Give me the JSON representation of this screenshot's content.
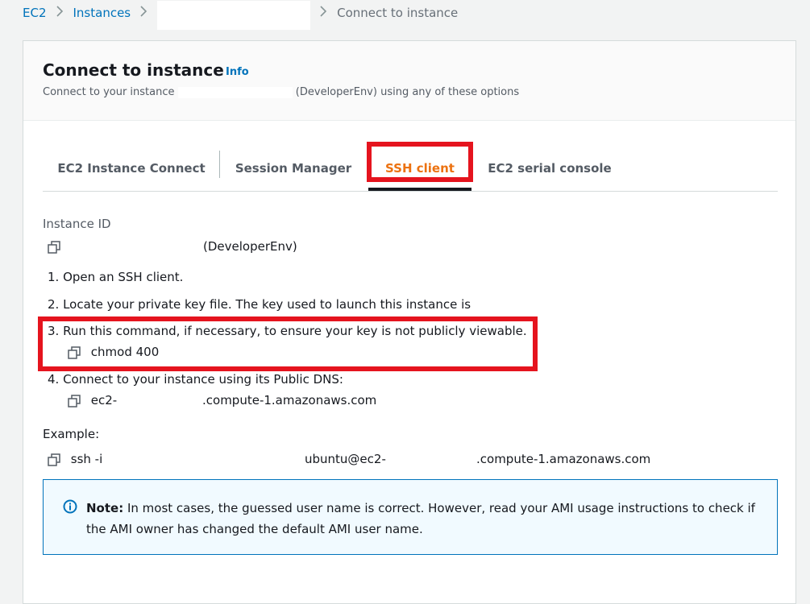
{
  "breadcrumb": {
    "items": [
      "EC2",
      "Instances"
    ],
    "current": "Connect to instance"
  },
  "header": {
    "title": "Connect to instance",
    "info_label": "Info",
    "subtitle_prefix": "Connect to your instance",
    "subtitle_suffix": "(DeveloperEnv) using any of these options"
  },
  "tabs": [
    {
      "label": "EC2 Instance Connect",
      "active": false
    },
    {
      "label": "Session Manager",
      "active": false
    },
    {
      "label": "SSH client",
      "active": true
    },
    {
      "label": "EC2 serial console",
      "active": false
    }
  ],
  "instance": {
    "label": "Instance ID",
    "name": "(DeveloperEnv)"
  },
  "steps": {
    "step1": "1. Open an SSH client.",
    "step2": "2. Locate your private key file. The key used to launch this instance is",
    "step3": "3. Run this command, if necessary, to ensure your key is not publicly viewable.",
    "step3_command": "chmod 400",
    "step4": "4. Connect to your instance using its Public DNS:",
    "step4_dns_prefix": "ec2-",
    "step4_dns_suffix": ".compute-1.amazonaws.com"
  },
  "example": {
    "label": "Example:",
    "command_prefix": "ssh -i",
    "command_user": "ubuntu@ec2-",
    "command_suffix": ".compute-1.amazonaws.com"
  },
  "note": {
    "strong": "Note:",
    "text": " In most cases, the guessed user name is correct. However, read your AMI usage instructions to check if the AMI owner has changed the default AMI user name."
  },
  "colors": {
    "link": "#0073bb",
    "active_tab": "#ec7211",
    "highlight": "#e5141e",
    "note_border": "#0073bb"
  }
}
